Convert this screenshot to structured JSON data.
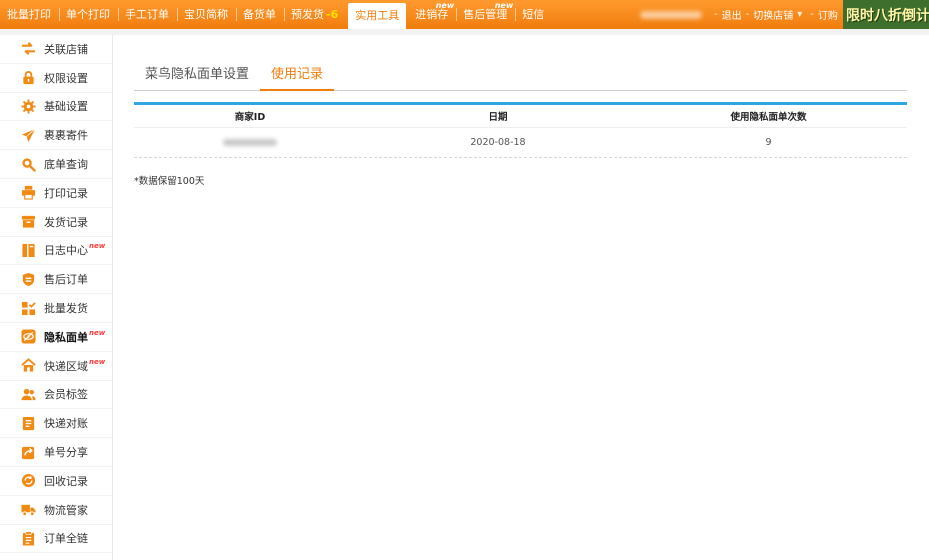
{
  "topnav": {
    "items": [
      {
        "label": "批量打印"
      },
      {
        "label": "单个打印"
      },
      {
        "label": "手工订单"
      },
      {
        "label": "宝贝简称"
      },
      {
        "label": "备货单"
      },
      {
        "label": "预发货",
        "highlight": "-6"
      },
      {
        "label": "实用工具",
        "active": true
      },
      {
        "label": "进销存",
        "badge": "new"
      },
      {
        "label": "售后管理",
        "badge": "new"
      },
      {
        "label": "短信"
      }
    ],
    "right": {
      "logout": "退出",
      "switch_shop": "切换店铺",
      "subscribe": "订购"
    },
    "promo": "限时八折倒计时"
  },
  "sidebar": {
    "items": [
      {
        "label": "关联店铺",
        "icon": "swap-arrows-icon"
      },
      {
        "label": "权限设置",
        "icon": "lock-icon"
      },
      {
        "label": "基础设置",
        "icon": "gear-icon"
      },
      {
        "label": "裹裹寄件",
        "icon": "paper-plane-icon"
      },
      {
        "label": "底单查询",
        "icon": "magnifier-icon"
      },
      {
        "label": "打印记录",
        "icon": "printer-icon"
      },
      {
        "label": "发货记录",
        "icon": "box-icon"
      },
      {
        "label": "日志中心",
        "icon": "log-book-icon",
        "badge": "new"
      },
      {
        "label": "售后订单",
        "icon": "shield-icon"
      },
      {
        "label": "批量发货",
        "icon": "grid-check-icon"
      },
      {
        "label": "隐私面单",
        "icon": "eye-off-icon",
        "badge": "new",
        "active": true
      },
      {
        "label": "快递区域",
        "icon": "home-icon",
        "badge": "new"
      },
      {
        "label": "会员标签",
        "icon": "users-icon"
      },
      {
        "label": "快递对账",
        "icon": "reconcile-icon"
      },
      {
        "label": "单号分享",
        "icon": "share-icon"
      },
      {
        "label": "回收记录",
        "icon": "recycle-icon"
      },
      {
        "label": "物流管家",
        "icon": "truck-icon"
      },
      {
        "label": "订单全链",
        "icon": "clipboard-icon"
      }
    ]
  },
  "main": {
    "tabs": [
      {
        "label": "菜鸟隐私面单设置",
        "active": false
      },
      {
        "label": "使用记录",
        "active": true
      }
    ],
    "table": {
      "headers": [
        "商家ID",
        "日期",
        "使用隐私面单次数"
      ],
      "rows": [
        {
          "merchant_id": "",
          "date": "2020-08-18",
          "count": "9"
        }
      ]
    },
    "note": "*数据保留100天"
  },
  "colors": {
    "brand_orange": "#f07d0c",
    "table_accent": "#2ea7e0",
    "icon_orange": "#f08a13"
  }
}
